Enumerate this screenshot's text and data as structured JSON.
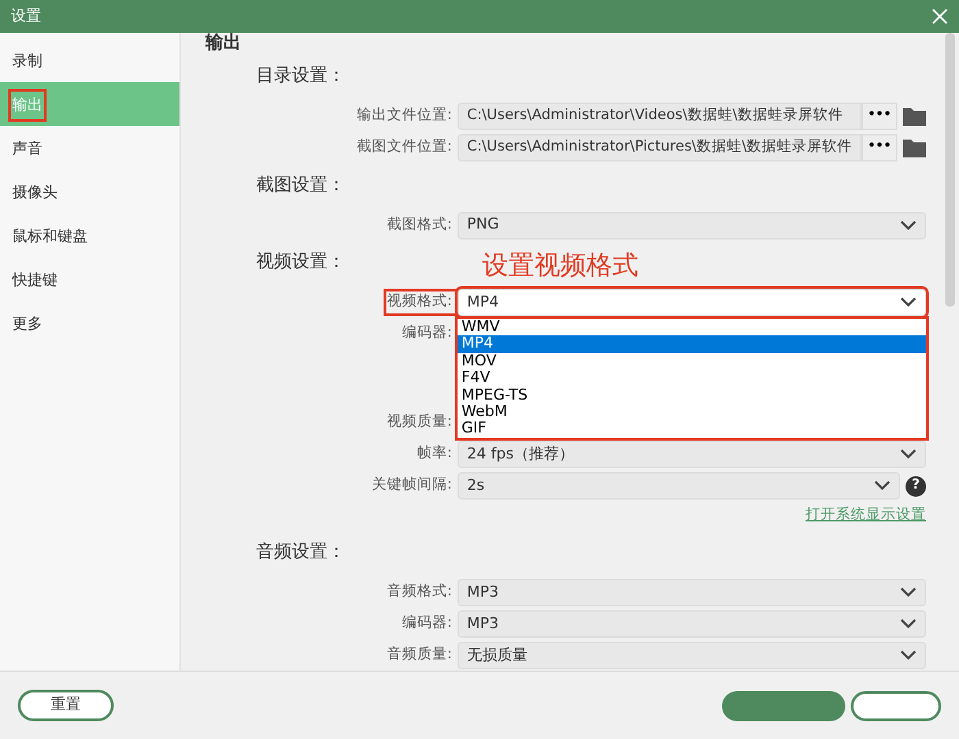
{
  "window": {
    "title": "设置"
  },
  "sidebar": {
    "items": [
      {
        "label": "录制",
        "selected": false,
        "highlighted": false
      },
      {
        "label": "输出",
        "selected": true,
        "highlighted": true
      },
      {
        "label": "声音",
        "selected": false,
        "highlighted": false
      },
      {
        "label": "摄像头",
        "selected": false,
        "highlighted": false
      },
      {
        "label": "鼠标和键盘",
        "selected": false,
        "highlighted": false
      },
      {
        "label": "快捷键",
        "selected": false,
        "highlighted": false
      },
      {
        "label": "更多",
        "selected": false,
        "highlighted": false
      }
    ]
  },
  "page_title": "输出",
  "sections": [
    {
      "title": "目录设置：",
      "rows": [
        {
          "kind": "path",
          "label": "输出文件位置:",
          "value": "C:\\Users\\Administrator\\Videos\\数据蛙\\数据蛙录屏软件",
          "button": "•••"
        },
        {
          "kind": "path",
          "label": "截图文件位置:",
          "value": "C:\\Users\\Administrator\\Pictures\\数据蛙\\数据蛙录屏软件",
          "button": "•••"
        }
      ]
    },
    {
      "title": "截图设置：",
      "rows": [
        {
          "kind": "select",
          "label": "截图格式:",
          "value": "PNG"
        }
      ]
    },
    {
      "title": "视频设置：",
      "annotation": "设置视频格式",
      "rows": [
        {
          "kind": "select",
          "label": "视频格式:",
          "value": "MP4",
          "highlighted": true,
          "open": true,
          "options": [
            {
              "label": "WMV",
              "selected": false
            },
            {
              "label": "MP4",
              "selected": true
            },
            {
              "label": "MOV",
              "selected": false
            },
            {
              "label": "F4V",
              "selected": false
            },
            {
              "label": "MPEG-TS",
              "selected": false
            },
            {
              "label": "WebM",
              "selected": false
            },
            {
              "label": "GIF",
              "selected": false
            }
          ]
        },
        {
          "kind": "hidden",
          "label": "编码器:"
        },
        {
          "kind": "spacer"
        },
        {
          "kind": "hidden",
          "label": "视频质量:"
        },
        {
          "kind": "select",
          "label": "帧率:",
          "value": "24 fps（推荐）"
        },
        {
          "kind": "select",
          "label": "关键帧间隔:",
          "value": "2s",
          "help": "?"
        }
      ],
      "link": "打开系统显示设置"
    },
    {
      "title": "音频设置：",
      "rows": [
        {
          "kind": "select",
          "label": "音频格式:",
          "value": "MP3"
        },
        {
          "kind": "select",
          "label": "编码器:",
          "value": "MP3"
        },
        {
          "kind": "select",
          "label": "音频质量:",
          "value": "无损质量"
        }
      ]
    }
  ],
  "footer": {
    "reset": "重置"
  }
}
